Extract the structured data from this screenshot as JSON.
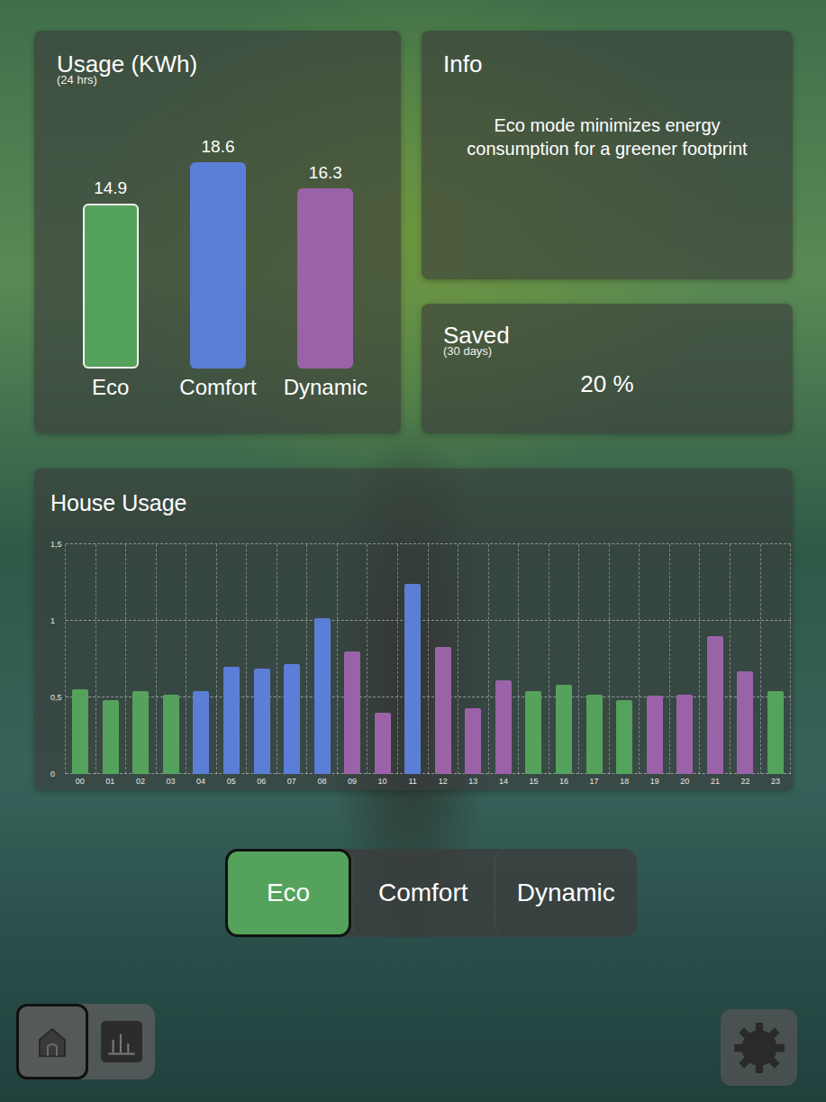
{
  "usage": {
    "title": "Usage (KWh)",
    "subtitle": "(24 hrs)",
    "bars": [
      {
        "label": "Eco",
        "reading": "14.9",
        "value": 14.9,
        "color": "#55a25c",
        "selected": true
      },
      {
        "label": "Comfort",
        "reading": "18.6",
        "value": 18.6,
        "color": "#5b7ed6",
        "selected": false
      },
      {
        "label": "Dynamic",
        "reading": "16.3",
        "value": 16.3,
        "color": "#9a63a8",
        "selected": false
      }
    ]
  },
  "info": {
    "title": "Info",
    "text": "Eco mode minimizes energy consumption for a greener footprint"
  },
  "saved": {
    "title": "Saved",
    "subtitle": "(30 days)",
    "value": "20 %"
  },
  "house_usage": {
    "title": "House Usage",
    "y_ticks": [
      {
        "label": "0",
        "value": 0
      },
      {
        "label": "0,5",
        "value": 0.5
      },
      {
        "label": "1",
        "value": 1
      },
      {
        "label": "1,5",
        "value": 1.5
      }
    ],
    "bars": [
      {
        "hour": "00",
        "value": 0.55,
        "color": "#55a25c"
      },
      {
        "hour": "01",
        "value": 0.48,
        "color": "#55a25c"
      },
      {
        "hour": "02",
        "value": 0.54,
        "color": "#55a25c"
      },
      {
        "hour": "03",
        "value": 0.52,
        "color": "#55a25c"
      },
      {
        "hour": "04",
        "value": 0.54,
        "color": "#5b7ed6"
      },
      {
        "hour": "05",
        "value": 0.7,
        "color": "#5b7ed6"
      },
      {
        "hour": "06",
        "value": 0.69,
        "color": "#5b7ed6"
      },
      {
        "hour": "07",
        "value": 0.72,
        "color": "#5b7ed6"
      },
      {
        "hour": "08",
        "value": 1.02,
        "color": "#5b7ed6"
      },
      {
        "hour": "09",
        "value": 0.8,
        "color": "#9a63a8"
      },
      {
        "hour": "10",
        "value": 0.4,
        "color": "#9a63a8"
      },
      {
        "hour": "11",
        "value": 1.24,
        "color": "#5b7ed6"
      },
      {
        "hour": "12",
        "value": 0.83,
        "color": "#9a63a8"
      },
      {
        "hour": "13",
        "value": 0.43,
        "color": "#9a63a8"
      },
      {
        "hour": "14",
        "value": 0.61,
        "color": "#9a63a8"
      },
      {
        "hour": "15",
        "value": 0.54,
        "color": "#55a25c"
      },
      {
        "hour": "16",
        "value": 0.58,
        "color": "#55a25c"
      },
      {
        "hour": "17",
        "value": 0.52,
        "color": "#55a25c"
      },
      {
        "hour": "18",
        "value": 0.48,
        "color": "#55a25c"
      },
      {
        "hour": "19",
        "value": 0.51,
        "color": "#9a63a8"
      },
      {
        "hour": "20",
        "value": 0.52,
        "color": "#9a63a8"
      },
      {
        "hour": "21",
        "value": 0.9,
        "color": "#9a63a8"
      },
      {
        "hour": "22",
        "value": 0.67,
        "color": "#9a63a8"
      },
      {
        "hour": "23",
        "value": 0.54,
        "color": "#55a25c"
      }
    ]
  },
  "modes": [
    {
      "label": "Eco",
      "selected": true,
      "color": "#55a25c"
    },
    {
      "label": "Comfort",
      "selected": false,
      "color": "#5b7ed6"
    },
    {
      "label": "Dynamic",
      "selected": false,
      "color": "#9a63a8"
    }
  ],
  "nav": [
    {
      "kind": "home",
      "selected": true
    },
    {
      "kind": "stats",
      "selected": false
    }
  ]
}
